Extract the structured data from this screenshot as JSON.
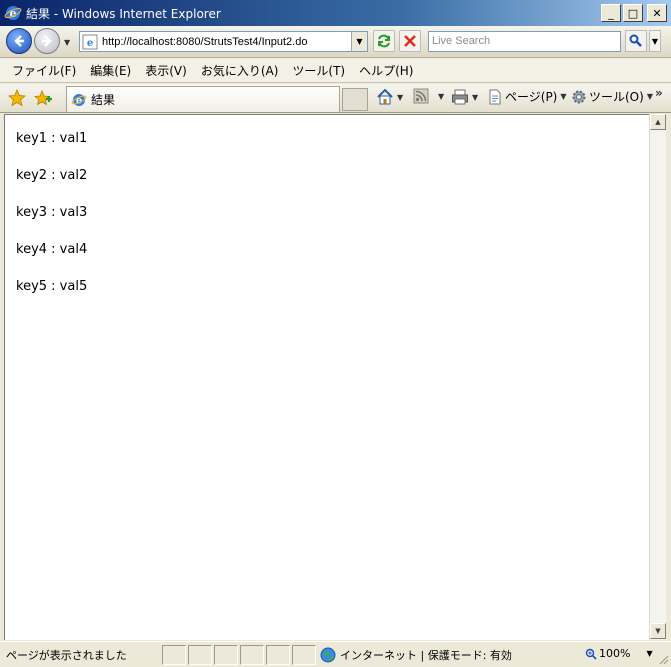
{
  "window": {
    "title": "結果 - Windows Internet Explorer",
    "min_glyph": "_",
    "max_glyph": "□",
    "close_glyph": "✕"
  },
  "address": {
    "url": "http://localhost:8080/StrutsTest4/Input2.do",
    "search_placeholder": "Live Search"
  },
  "menu": {
    "items": [
      "ファイル(F)",
      "編集(E)",
      "表示(V)",
      "お気に入り(A)",
      "ツール(T)",
      "ヘルプ(H)"
    ]
  },
  "tab": {
    "title": "結果"
  },
  "commands": {
    "page_label": "ページ(P)",
    "tools_label": "ツール(O)",
    "chevron": "»"
  },
  "content": {
    "lines": [
      "key1 : val1",
      "key2 : val2",
      "key3 : val3",
      "key4 : val4",
      "key5 : val5"
    ]
  },
  "status": {
    "text": "ページが表示されました",
    "zone": "インターネット | 保護モード: 有効",
    "zoom": "100%"
  },
  "colors": {
    "title_gradient_start": "#0a246a",
    "title_gradient_end": "#a6caf0",
    "chrome": "#ece9d8"
  }
}
